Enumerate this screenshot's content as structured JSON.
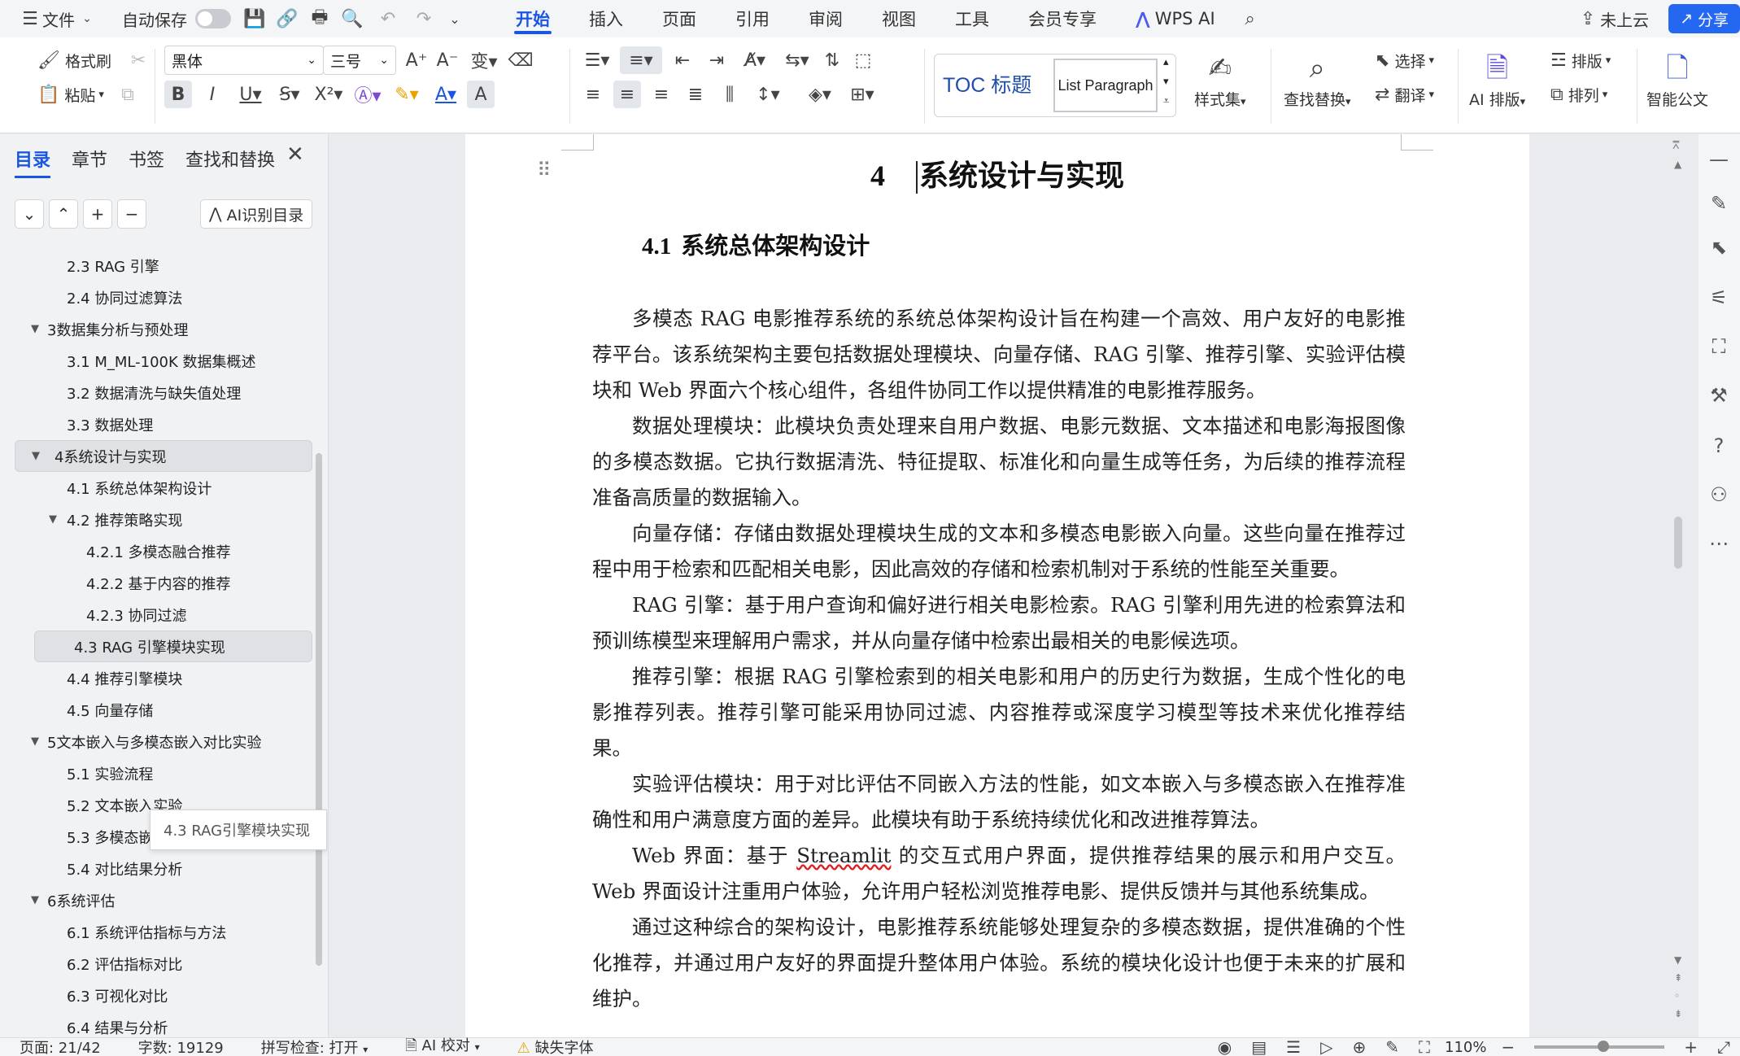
{
  "menubar": {
    "menu_label": "文件",
    "autosave_label": "自动保存",
    "tabs": [
      "开始",
      "插入",
      "页面",
      "引用",
      "审阅",
      "视图",
      "工具",
      "会员专享",
      "WPS AI"
    ],
    "cloud_label": "未上云",
    "share_label": "分享"
  },
  "ribbon": {
    "format_painter": "格式刷",
    "paste": "粘贴",
    "font_name": "黑体",
    "font_size": "三号",
    "style_toc": "TOC 标题",
    "style_lp": "List Paragraph",
    "style_set": "样式集",
    "find_replace": "查找替换",
    "select": "选择",
    "translate": "翻译",
    "ai_layout": "AI 排版",
    "layout": "排版",
    "arrange": "排列",
    "smart_doc": "智能公文"
  },
  "nav": {
    "tabs": [
      "目录",
      "章节",
      "书签",
      "查找和替换"
    ],
    "ai_toc_label": "AI识别目录",
    "tooltip": "4.3 RAG引擎模块实现",
    "items": [
      {
        "label": "2.3 RAG 引擎",
        "level": 2
      },
      {
        "label": "2.4 协同过滤算法",
        "level": 2
      },
      {
        "label": "3数据集分析与预处理",
        "level": 1
      },
      {
        "label": "3.1 M_ML-100K 数据集概述",
        "level": 2
      },
      {
        "label": "3.2 数据清洗与缺失值处理",
        "level": 2
      },
      {
        "label": "3.3 数据处理",
        "level": 2
      },
      {
        "label": "4系统设计与实现",
        "level": 1
      },
      {
        "label": "4.1 系统总体架构设计",
        "level": 2
      },
      {
        "label": "4.2 推荐策略实现",
        "level": 2
      },
      {
        "label": "4.2.1 多模态融合推荐",
        "level": 3
      },
      {
        "label": "4.2.2 基于内容的推荐",
        "level": 3
      },
      {
        "label": "4.2.3 协同过滤",
        "level": 3
      },
      {
        "label": "4.3 RAG 引擎模块实现",
        "level": 2
      },
      {
        "label": "4.4 推荐引擎模块",
        "level": 2
      },
      {
        "label": "4.5 向量存储",
        "level": 2
      },
      {
        "label": "5文本嵌入与多模态嵌入对比实验",
        "level": 1
      },
      {
        "label": "5.1 实验流程",
        "level": 2
      },
      {
        "label": "5.2 文本嵌入实验",
        "level": 2
      },
      {
        "label": "5.3 多模态嵌入实验",
        "level": 2
      },
      {
        "label": "5.4 对比结果分析",
        "level": 2
      },
      {
        "label": "6系统评估",
        "level": 1
      },
      {
        "label": "6.1 系统评估指标与方法",
        "level": 2
      },
      {
        "label": "6.2 评估指标对比",
        "level": 2
      },
      {
        "label": "6.3 可视化对比",
        "level": 2
      },
      {
        "label": "6.4 结果与分析",
        "level": 2
      }
    ]
  },
  "document": {
    "chapter_num": "4",
    "chapter_title": "系统设计与实现",
    "section_num": "4.1",
    "section_title": "系统总体架构设计",
    "p1": "多模态 RAG 电影推荐系统的系统总体架构设计旨在构建一个高效、用户友好的电影推荐平台。该系统架构主要包括数据处理模块、向量存储、RAG 引擎、推荐引擎、实验评估模块和 Web 界面六个核心组件，各组件协同工作以提供精准的电影推荐服务。",
    "p2": "数据处理模块：此模块负责处理来自用户数据、电影元数据、文本描述和电影海报图像的多模态数据。它执行数据清洗、特征提取、标准化和向量生成等任务，为后续的推荐流程准备高质量的数据输入。",
    "p3": "向量存储：存储由数据处理模块生成的文本和多模态电影嵌入向量。这些向量在推荐过程中用于检索和匹配相关电影，因此高效的存储和检索机制对于系统的性能至关重要。",
    "p4": "RAG 引擎：基于用户查询和偏好进行相关电影检索。RAG 引擎利用先进的检索算法和预训练模型来理解用户需求，并从向量存储中检索出最相关的电影候选项。",
    "p5": "推荐引擎：根据 RAG 引擎检索到的相关电影和用户的历史行为数据，生成个性化的电影推荐列表。推荐引擎可能采用协同过滤、内容推荐或深度学习模型等技术来优化推荐结果。",
    "p6": "实验评估模块：用于对比评估不同嵌入方法的性能，如文本嵌入与多模态嵌入在推荐准确性和用户满意度方面的差异。此模块有助于系统持续优化和改进推荐算法。",
    "p7_pre": "Web 界面：基于 ",
    "p7_word": "Streamlit",
    "p7_post": " 的交互式用户界面，提供推荐结果的展示和用户交互。Web 界面设计注重用户体验，允许用户轻松浏览推荐电影、提供反馈并与其他系统集成。",
    "p8": "通过这种综合的架构设计，电影推荐系统能够处理复杂的多模态数据，提供准确的个性化推荐，并通过用户友好的界面提升整体用户体验。系统的模块化设计也便于未来的扩展和维护。"
  },
  "status": {
    "page": "页面: 21/42",
    "words": "字数: 19129",
    "spell": "拼写检查: 打开",
    "ai_check": "AI 校对",
    "missing_font": "缺失字体",
    "zoom": "110%"
  }
}
